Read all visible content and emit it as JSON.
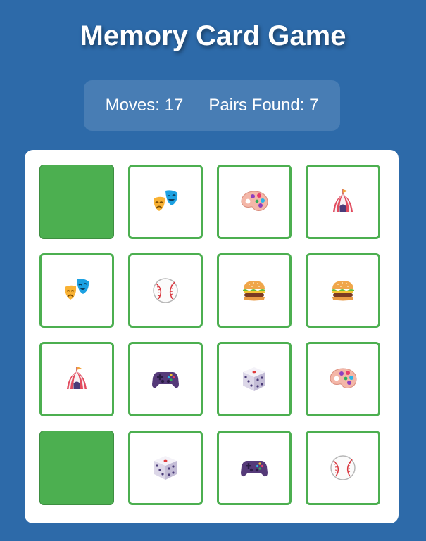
{
  "title": "Memory Card Game",
  "stats": {
    "moves_label": "Moves:",
    "moves": 17,
    "pairs_label": "Pairs Found:",
    "pairs": 7
  },
  "colors": {
    "background": "#2d6aa9",
    "card_back": "#4caf50",
    "card_border": "#4caf50"
  },
  "cards": [
    {
      "state": "hidden",
      "icon": null
    },
    {
      "state": "revealed",
      "icon": "performing-arts"
    },
    {
      "state": "revealed",
      "icon": "artist-palette"
    },
    {
      "state": "revealed",
      "icon": "circus-tent"
    },
    {
      "state": "revealed",
      "icon": "performing-arts"
    },
    {
      "state": "revealed",
      "icon": "baseball"
    },
    {
      "state": "revealed",
      "icon": "hamburger"
    },
    {
      "state": "revealed",
      "icon": "hamburger"
    },
    {
      "state": "revealed",
      "icon": "circus-tent"
    },
    {
      "state": "revealed",
      "icon": "video-game"
    },
    {
      "state": "revealed",
      "icon": "game-die"
    },
    {
      "state": "revealed",
      "icon": "artist-palette"
    },
    {
      "state": "hidden",
      "icon": null
    },
    {
      "state": "revealed",
      "icon": "game-die"
    },
    {
      "state": "revealed",
      "icon": "video-game"
    },
    {
      "state": "revealed",
      "icon": "baseball"
    }
  ]
}
